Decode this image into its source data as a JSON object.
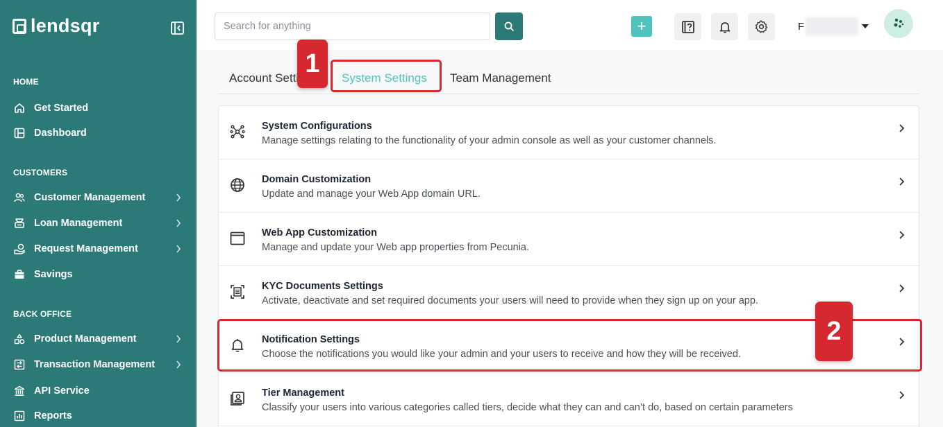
{
  "app": {
    "logo_text": "lendsqr"
  },
  "sidebar": {
    "sections": [
      {
        "label": "HOME",
        "items": [
          {
            "label": "Get Started",
            "icon": "home-icon",
            "chevron": false
          },
          {
            "label": "Dashboard",
            "icon": "dashboard-icon",
            "chevron": false
          }
        ]
      },
      {
        "label": "CUSTOMERS",
        "items": [
          {
            "label": "Customer Management",
            "icon": "users-icon",
            "chevron": true
          },
          {
            "label": "Loan Management",
            "icon": "loan-icon",
            "chevron": true
          },
          {
            "label": "Request Management",
            "icon": "hand-coin-icon",
            "chevron": true
          },
          {
            "label": "Savings",
            "icon": "briefcase-icon",
            "chevron": false
          }
        ]
      },
      {
        "label": "BACK OFFICE",
        "items": [
          {
            "label": "Product Management",
            "icon": "product-icon",
            "chevron": true
          },
          {
            "label": "Transaction Management",
            "icon": "transaction-icon",
            "chevron": true
          },
          {
            "label": "API Service",
            "icon": "bank-icon",
            "chevron": false
          },
          {
            "label": "Reports",
            "icon": "reports-icon",
            "chevron": false
          }
        ]
      }
    ]
  },
  "topbar": {
    "search_placeholder": "Search for anything",
    "plus_label": "+",
    "user_initial": "F"
  },
  "tabs": [
    {
      "label": "Account Settings",
      "active": false
    },
    {
      "label": "System Settings",
      "active": true
    },
    {
      "label": "Team Management",
      "active": false
    }
  ],
  "callouts": [
    {
      "number": "1"
    },
    {
      "number": "2"
    }
  ],
  "settings": [
    {
      "title": "System Configurations",
      "description": "Manage settings relating to the functionality of your admin console as well as your customer channels.",
      "icon": "network-nodes-icon"
    },
    {
      "title": "Domain Customization",
      "description": "Update and manage your Web App domain URL.",
      "icon": "globe-icon"
    },
    {
      "title": "Web App Customization",
      "description": "Manage and update your Web app properties from Pecunia.",
      "icon": "browser-window-icon"
    },
    {
      "title": "KYC Documents Settings",
      "description": "Activate, deactivate and set required documents your users will need to provide when they sign up on your app.",
      "icon": "document-scan-icon"
    },
    {
      "title": "Notification Settings",
      "description": "Choose the notifications you would like your admin and your users to receive and how they will be received.",
      "icon": "bell-icon"
    },
    {
      "title": "Tier Management",
      "description": "Classify your users into various categories called tiers, decide what they can and can’t do, based on certain parameters",
      "icon": "user-id-card-icon"
    }
  ],
  "colors": {
    "sidebar": "#2b7a78",
    "accent": "#4fc4bc",
    "callout": "#d6282f"
  }
}
